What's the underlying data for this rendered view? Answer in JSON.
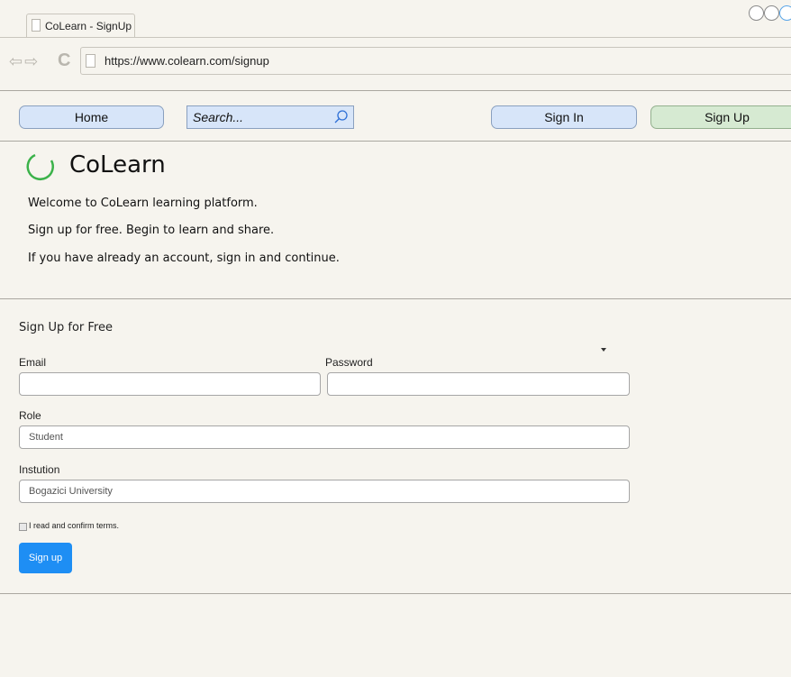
{
  "browser": {
    "tab_title": "CoLearn - SignUp",
    "url": "https://www.colearn.com/signup",
    "icons": [
      "back-arrow-icon",
      "forward-arrow-icon",
      "reload-icon",
      "document-icon"
    ]
  },
  "toolbar": {
    "home_label": "Home",
    "search_placeholder": "Search...",
    "signin_label": "Sign In",
    "signup_label": "Sign Up"
  },
  "brand": {
    "name": "CoLearn",
    "logo_color": "#3bb24a"
  },
  "intro": {
    "line1": "Welcome to CoLearn learning platform.",
    "line2": "Sign up for free. Begin to learn and share.",
    "line3": "If you have already an account, sign in and continue."
  },
  "form": {
    "title": "Sign Up for Free",
    "email_label": "Email",
    "email_value": "",
    "password_label": "Password",
    "password_value": "",
    "role_label": "Role",
    "role_value": "Student",
    "institution_label": "Instution",
    "institution_value": "Bogazici University",
    "terms_label": "I read and confirm terms.",
    "terms_checked": false,
    "submit_label": "Sign up"
  },
  "colors": {
    "accent_blue": "#1e8ef4",
    "pill_blue": "#d7e5f9",
    "pill_green": "#d6ead2",
    "background": "#f6f4ee"
  }
}
